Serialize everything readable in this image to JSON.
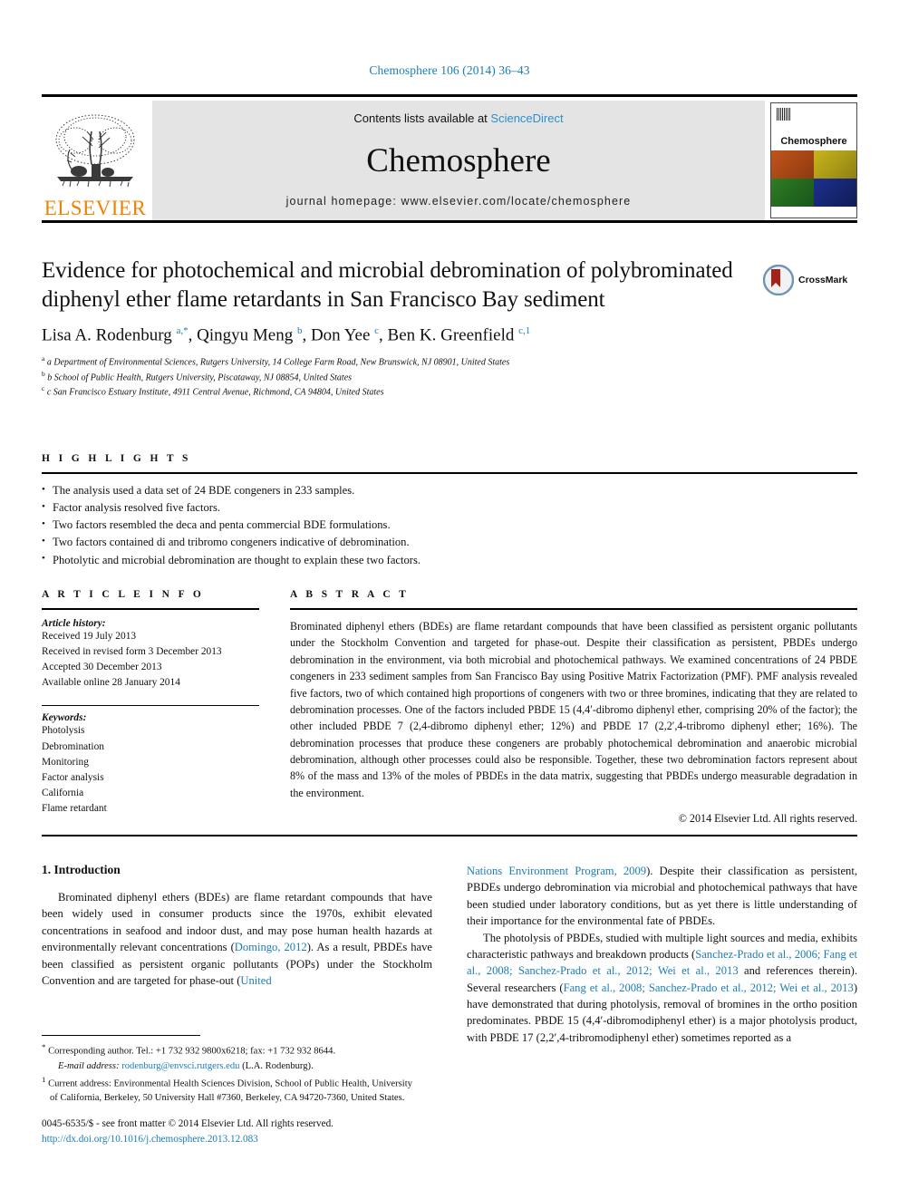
{
  "running_head": "Chemosphere 106 (2014) 36–43",
  "masthead": {
    "contents_prefix": "Contents lists available at ",
    "sciencedirect": "ScienceDirect",
    "journal_name": "Chemosphere",
    "homepage": "journal homepage: www.elsevier.com/locate/chemosphere",
    "publisher_logo_text": "ELSEVIER",
    "cover_title": "Chemosphere",
    "accent_blue": "#2b8fd0",
    "elsevier_orange": "#ef8200",
    "band_gray": "#e4e4e4"
  },
  "title_block": {
    "title": "Evidence for photochemical and microbial debromination of polybrominated diphenyl ether flame retardants in San Francisco Bay sediment",
    "authors_html": "Lisa A. Rodenburg <sup>a,*</sup>, Qingyu Meng <sup>b</sup>, Don Yee <sup>c</sup>, Ben K. Greenfield <sup>c,1</sup>",
    "affiliations": [
      "a Department of Environmental Sciences, Rutgers University, 14 College Farm Road, New Brunswick, NJ 08901, United States",
      "b School of Public Health, Rutgers University, Piscataway, NJ 08854, United States",
      "c San Francisco Estuary Institute, 4911 Central Avenue, Richmond, CA 94804, United States"
    ],
    "crossmark_label": "CrossMark"
  },
  "highlights": {
    "label": "H I G H L I G H T S",
    "items": [
      "The analysis used a data set of 24 BDE congeners in 233 samples.",
      "Factor analysis resolved five factors.",
      "Two factors resembled the deca and penta commercial BDE formulations.",
      "Two factors contained di and tribromo congeners indicative of debromination.",
      "Photolytic and microbial debromination are thought to explain these two factors."
    ]
  },
  "article_info": {
    "label": "A R T I C L E   I N F O",
    "history_label": "Article history:",
    "history": [
      "Received 19 July 2013",
      "Received in revised form 3 December 2013",
      "Accepted 30 December 2013",
      "Available online 28 January 2014"
    ],
    "keywords_label": "Keywords:",
    "keywords": [
      "Photolysis",
      "Debromination",
      "Monitoring",
      "Factor analysis",
      "California",
      "Flame retardant"
    ]
  },
  "abstract": {
    "label": "A B S T R A C T",
    "text": "Brominated diphenyl ethers (BDEs) are flame retardant compounds that have been classified as persistent organic pollutants under the Stockholm Convention and targeted for phase-out. Despite their classification as persistent, PBDEs undergo debromination in the environment, via both microbial and photochemical pathways. We examined concentrations of 24 PBDE congeners in 233 sediment samples from San Francisco Bay using Positive Matrix Factorization (PMF). PMF analysis revealed five factors, two of which contained high proportions of congeners with two or three bromines, indicating that they are related to debromination processes. One of the factors included PBDE 15 (4,4′-dibromo diphenyl ether, comprising 20% of the factor); the other included PBDE 7 (2,4-dibromo diphenyl ether; 12%) and PBDE 17 (2,2′,4-tribromo diphenyl ether; 16%). The debromination processes that produce these congeners are probably photochemical debromination and anaerobic microbial debromination, although other processes could also be responsible. Together, these two debromination factors represent about 8% of the mass and 13% of the moles of PBDEs in the data matrix, suggesting that PBDEs undergo measurable degradation in the environment.",
    "copyright": "© 2014 Elsevier Ltd. All rights reserved."
  },
  "body": {
    "section_heading": "1. Introduction",
    "left_paragraph_html": "Brominated diphenyl ethers (BDEs) are flame retardant compounds that have been widely used in consumer products since the 1970s, exhibit elevated concentrations in seafood and indoor dust, and may pose human health hazards at environmentally relevant concentrations (<span class=\"ref\">Domingo, 2012</span>). As a result, PBDEs have been classified as persistent organic pollutants (POPs) under the Stockholm Convention and are targeted for phase-out (<span class=\"ref\">United</span>",
    "right_paragraph_1_html": "<span class=\"ref\">Nations Environment Program, 2009</span>). Despite their classification as persistent, PBDEs undergo debromination via microbial and photochemical pathways that have been studied under laboratory conditions, but as yet there is little understanding of their importance for the environmental fate of PBDEs.",
    "right_paragraph_2_html": "The photolysis of PBDEs, studied with multiple light sources and media, exhibits characteristic pathways and breakdown products (<span class=\"ref\">Sanchez-Prado et al., 2006; Fang et al., 2008; Sanchez-Prado et al., 2012; Wei et al., 2013</span> and references therein). Several researchers (<span class=\"ref\">Fang et al., 2008; Sanchez-Prado et al., 2012; Wei et al., 2013</span>) have demonstrated that during photolysis, removal of bromines in the ortho position predominates. PBDE 15 (4,4′-dibromodiphenyl ether) is a major photolysis product, with PBDE 17 (2,2′,4-tribromodiphenyl ether) sometimes reported as a"
  },
  "footnotes": {
    "corresponding_html": "<sup>*</sup> Corresponding author. Tel.: +1 732 932 9800x6218; fax: +1 732 932 8644.",
    "email_html": "<em>E-mail address:</em> <span class=\"ref\">rodenburg@envsci.rutgers.edu</span> (L.A. Rodenburg).",
    "current_address_html": "<sup>1</sup> Current address: Environmental Health Sciences Division, School of Public Health, University of California, Berkeley, 50 University Hall #7360, Berkeley, CA 94720-7360, United States."
  },
  "issn_block": {
    "front_matter": "0045-6535/$ - see front matter © 2014 Elsevier Ltd. All rights reserved.",
    "doi": "http://dx.doi.org/10.1016/j.chemosphere.2013.12.083"
  }
}
